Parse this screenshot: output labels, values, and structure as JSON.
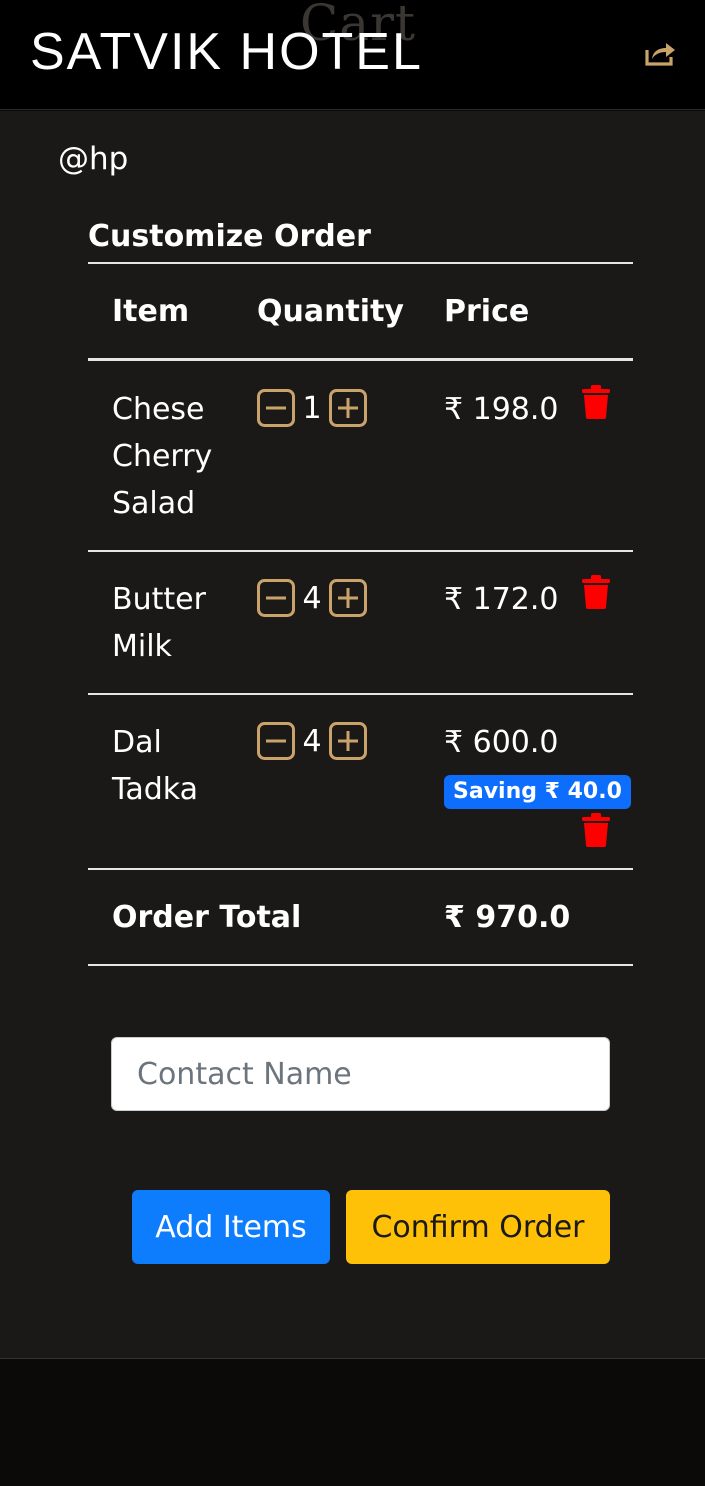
{
  "header": {
    "ghost_title": "Cart",
    "brand": "SATVIK HOTEL",
    "share_icon": "share-icon"
  },
  "user": {
    "handle": "@hp"
  },
  "table": {
    "caption": "Customize Order",
    "columns": [
      "Item",
      "Quantity",
      "Price"
    ],
    "rows": [
      {
        "item_lines": [
          "Chese",
          "Cherry",
          "Salad"
        ],
        "quantity": "1",
        "price": "₹ 198.0"
      },
      {
        "item_lines": [
          "Butter",
          "Milk"
        ],
        "quantity": "4",
        "price": "₹ 172.0"
      },
      {
        "item_lines": [
          "Dal",
          "Tadka"
        ],
        "quantity": "4",
        "price": "₹ 600.0",
        "saving": "Saving ₹ 40.0"
      }
    ],
    "total_label": "Order Total",
    "total_value": "₹ 970.0"
  },
  "form": {
    "contact_placeholder": "Contact Name",
    "contact_value": ""
  },
  "actions": {
    "add_items": "Add Items",
    "confirm_order": "Confirm Order"
  },
  "colors": {
    "accent_gold": "#c9a36a",
    "delete_red": "#ff0000",
    "primary_blue": "#0d7dfd",
    "warning_yellow": "#ffc107",
    "panel_bg": "#1b1917"
  }
}
